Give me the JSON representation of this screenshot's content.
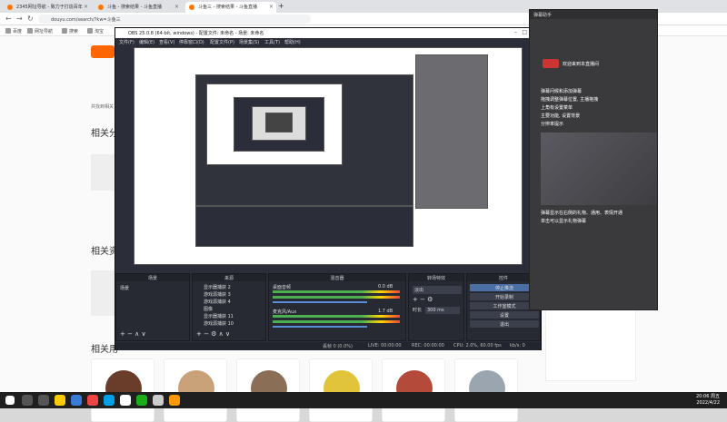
{
  "browser": {
    "tabs": [
      {
        "label": "2345网址导航 - 致力于打造百年"
      },
      {
        "label": "斗鱼 - 搜索结果 - 斗鱼直播"
      },
      {
        "label": "斗鱼三 - 搜索结果 - 斗鱼直播"
      }
    ],
    "url": "douyu.com/search/?kw=斗鱼三",
    "bookmarks": [
      "百度",
      "网址导航",
      "搜索",
      "淘宝",
      "京东"
    ]
  },
  "page": {
    "related_label_1": "相关分",
    "related_label_2": "相关资",
    "related_label_3": "相关用",
    "search_hint": "共找到相关",
    "side_note_1": "相关",
    "side_note_2": "相关",
    "avatar_colors": [
      "#6a3d2a",
      "#c9a27a",
      "#8a6e55",
      "#e2c43a",
      "#b34a3a",
      "#9aa5b0"
    ]
  },
  "obs": {
    "title": "OBS 25.0.8 (64-bit, windows) - 配置文件: 未命名 - 场景: 未命名",
    "menu": [
      "文件(F)",
      "编辑(E)",
      "查看(V)",
      "停靠窗口(D)",
      "配置文件(P)",
      "场景集(S)",
      "工具(T)",
      "帮助(H)"
    ],
    "docks": {
      "scenes": {
        "title": "场景",
        "items": [
          "场景"
        ]
      },
      "sources": {
        "title": "来源",
        "items": [
          "显示器捕获 2",
          "游戏源捕获 3",
          "游戏源捕获 4",
          "图像",
          "显示器捕获 11",
          "游戏源捕获 10"
        ]
      },
      "mixer": {
        "title": "混音器",
        "channels": [
          {
            "name": "桌面音频",
            "db": "0.0 dB"
          },
          {
            "name": "麦克风/Aux",
            "db": "1.7 dB"
          }
        ]
      },
      "transitions": {
        "title": "转场特效",
        "type": "淡出",
        "duration_label": "时长",
        "duration": "300 ms"
      },
      "controls": {
        "title": "控件",
        "buttons": [
          "停止推流",
          "开始录制",
          "工作室模式",
          "设置",
          "退出"
        ]
      }
    },
    "status": {
      "drop": "丢帧 0 (0.0%)",
      "live": "LIVE: 00:00:00",
      "rec": "REC: 00:00:00",
      "cpu": "CPU: 2.0%, 60.00 fps",
      "kb": "kb/s: 0"
    }
  },
  "chat": {
    "title": "弹幕助手",
    "lines": [
      "欢迎来到本直播间",
      "弹幕问候和添加弹幕",
      "拖拽调整弹幕位置, 主播拖拽",
      "上角有设置菜单",
      "主要功能, 设置背景",
      "分辨率提示"
    ],
    "footer_lines": [
      "弹幕显示在右侧的礼物、通用、表情开通",
      "单击可以显示礼物弹幕"
    ]
  },
  "taskbar": {
    "time": "20:06 周五",
    "date": "2022/4/22",
    "icon_colors": [
      "#ffcc00",
      "#3a7bd5",
      "#e44",
      "#00a0e9",
      "#fff",
      "#1aad19",
      "#ccc",
      "#f90"
    ]
  }
}
